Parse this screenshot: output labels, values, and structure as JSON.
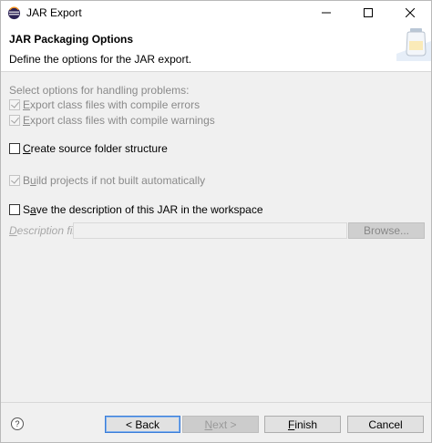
{
  "window": {
    "title": "JAR Export"
  },
  "banner": {
    "title": "JAR Packaging Options",
    "description": "Define the options for the JAR export."
  },
  "options": {
    "section_label": "Select options for handling problems:",
    "export_errors": {
      "prefix": "E",
      "rest": "xport class files with compile errors",
      "checked": true,
      "enabled": false
    },
    "export_warnings": {
      "prefix": "",
      "underline": "E",
      "rest": "xport class files with compile warnings",
      "checked": true,
      "enabled": false
    },
    "create_source": {
      "underline": "C",
      "rest": "reate source folder structure",
      "checked": false,
      "enabled": true
    },
    "build_projects": {
      "pre": "B",
      "underline": "u",
      "rest": "ild projects if not built automatically",
      "checked": true,
      "enabled": false
    },
    "save_description": {
      "pre": "S",
      "underline": "a",
      "rest": "ve the description of this JAR in the workspace",
      "checked": false,
      "enabled": true
    }
  },
  "description_file": {
    "label_underline": "D",
    "label_rest": "escription file:",
    "value": "",
    "browse_label": "Browse..."
  },
  "buttons": {
    "back": "< Back",
    "next_underline": "N",
    "next_rest": "ext >",
    "finish_underline": "F",
    "finish_rest": "inish",
    "cancel": "Cancel",
    "help": "?"
  }
}
